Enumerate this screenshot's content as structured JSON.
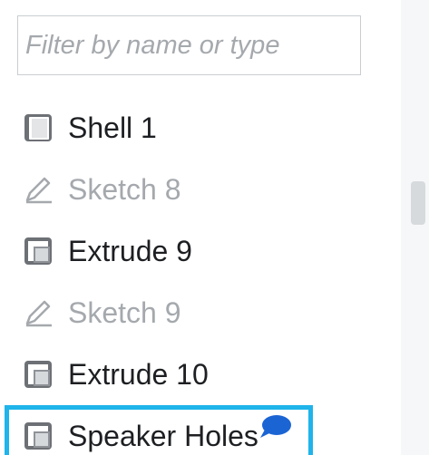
{
  "filter": {
    "placeholder": "Filter by name or type",
    "value": ""
  },
  "features": [
    {
      "label": "Shell 1",
      "icon": "part-icon",
      "state": "normal"
    },
    {
      "label": "Sketch 8",
      "icon": "sketch-pencil-icon",
      "state": "suppressed"
    },
    {
      "label": "Extrude 9",
      "icon": "extrude-icon",
      "state": "normal"
    },
    {
      "label": "Sketch 9",
      "icon": "sketch-pencil-icon",
      "state": "suppressed"
    },
    {
      "label": "Extrude 10",
      "icon": "extrude-icon",
      "state": "normal"
    },
    {
      "label": "Speaker Holes",
      "icon": "extrude-icon",
      "state": "selected",
      "has_comment": true
    }
  ],
  "colors": {
    "selection_border": "#1fb4ea",
    "comment_icon": "#1b64d4",
    "suppressed_text": "#a5a9ad",
    "text": "#1d1f22"
  }
}
